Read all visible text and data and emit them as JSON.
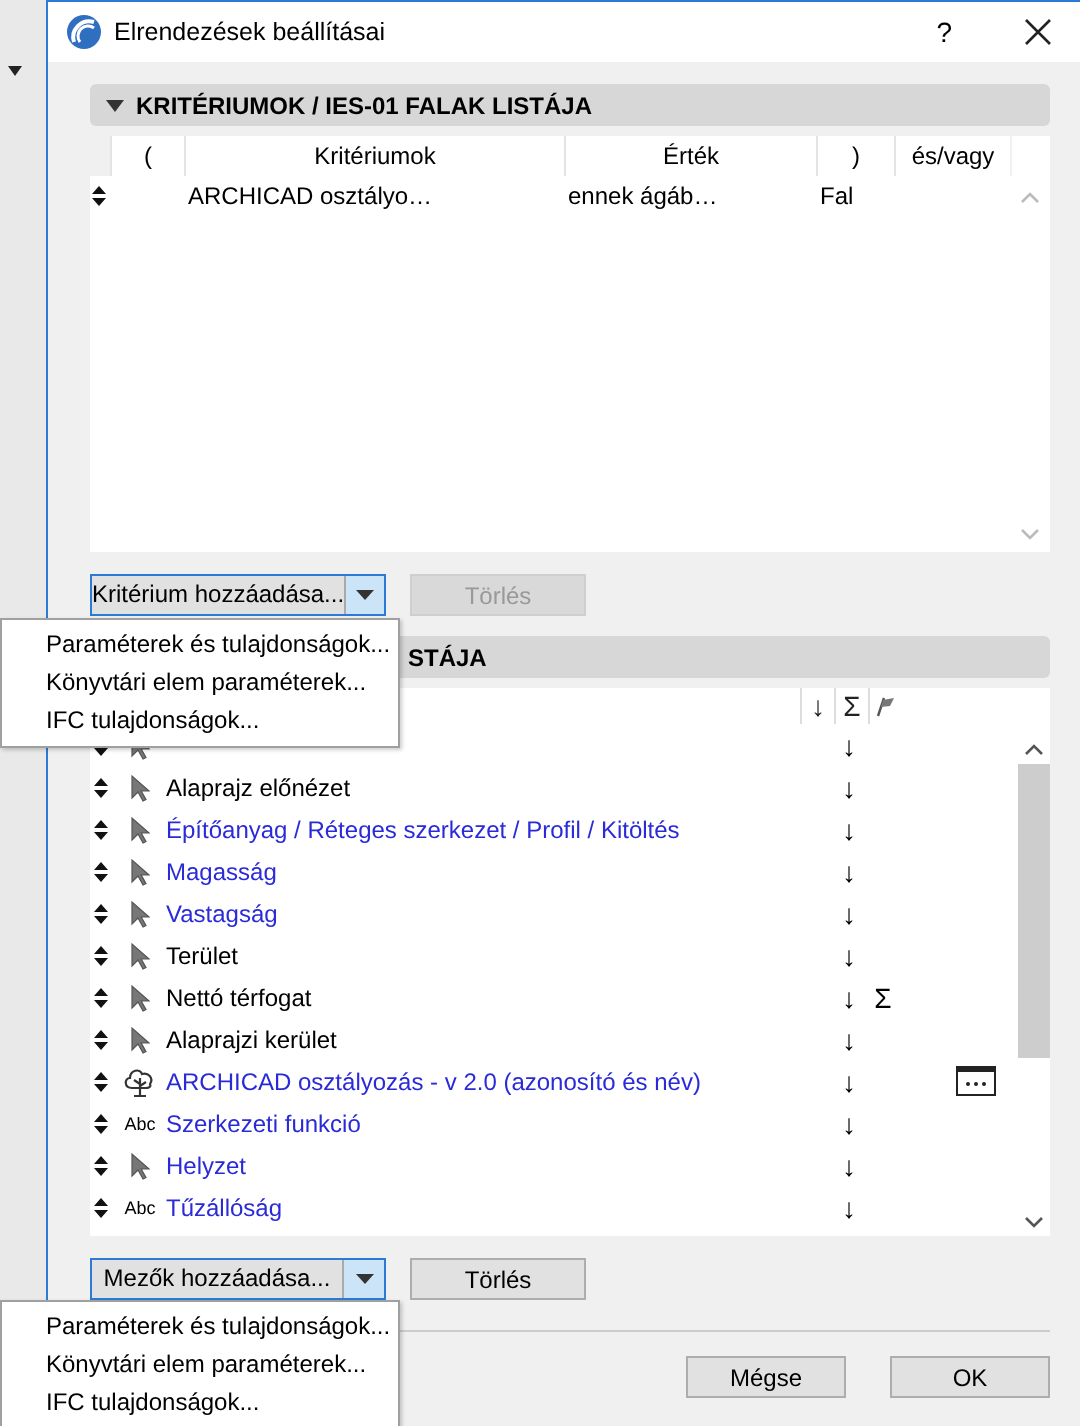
{
  "window": {
    "title": "Elrendezések beállításai",
    "help": "?"
  },
  "criteria_section": {
    "title": "KRITÉRIUMOK / IES-01 FALAK LISTÁJA",
    "expanded": true,
    "columns": [
      "(",
      "Kritériumok",
      "Érték",
      ")",
      "és/vagy"
    ],
    "rows": [
      {
        "criterion": "ARCHICAD osztályo…",
        "operator": "ennek ágáb…",
        "value": "Fal"
      }
    ],
    "add_button": "Kritérium hozzáadása...",
    "delete_button": {
      "label": "Törlés",
      "disabled": true
    }
  },
  "fields_section": {
    "title": "STÁJA",
    "columns": {
      "sort": "↓",
      "sum": "Σ"
    },
    "rows": [
      {
        "kind": "pointer",
        "sort": "↓"
      },
      {
        "kind": "pointer",
        "label": "Alaprajz előnézet",
        "sort": "↓",
        "color": "#000000"
      },
      {
        "kind": "pointer",
        "label": "Építőanyag / Réteges szerkezet / Profil / Kitöltés",
        "sort": "↓",
        "color": "#2a2ad8"
      },
      {
        "kind": "pointer",
        "label": "Magasság",
        "sort": "↓",
        "color": "#2a2ad8"
      },
      {
        "kind": "pointer",
        "label": "Vastagság",
        "sort": "↓",
        "color": "#2a2ad8"
      },
      {
        "kind": "pointer",
        "label": "Terület",
        "sort": "↓",
        "color": "#000000"
      },
      {
        "kind": "pointer",
        "label": "Nettó térfogat",
        "sort": "↓",
        "sum": "Σ",
        "color": "#000000"
      },
      {
        "kind": "pointer",
        "label": "Alaprajzi kerület",
        "sort": "↓",
        "color": "#000000"
      },
      {
        "kind": "tree",
        "label": "ARCHICAD osztályozás - v 2.0 (azonosító és név)",
        "sort": "↓",
        "options": true,
        "color": "#2a2ad8"
      },
      {
        "kind": "text",
        "icon": "Abc",
        "label": "Szerkezeti funkció",
        "sort": "↓",
        "color": "#2a2ad8"
      },
      {
        "kind": "pointer",
        "label": "Helyzet",
        "sort": "↓",
        "color": "#2a2ad8"
      },
      {
        "kind": "text",
        "icon": "Abc",
        "label": "Tűzállóság",
        "sort": "↓",
        "color": "#2a2ad8"
      }
    ],
    "add_button": "Mezők hozzáadása...",
    "delete_button": {
      "label": "Törlés",
      "disabled": false
    }
  },
  "buttons": [
    "Mégse",
    "OK"
  ],
  "criteria_menu": [
    "Paraméterek és tulajdonságok...",
    "Könyvtári elem paraméterek...",
    "IFC tulajdonságok..."
  ],
  "fields_menu": [
    "Paraméterek és tulajdonságok...",
    "Könyvtári elem paraméterek...",
    "IFC tulajdonságok..."
  ]
}
